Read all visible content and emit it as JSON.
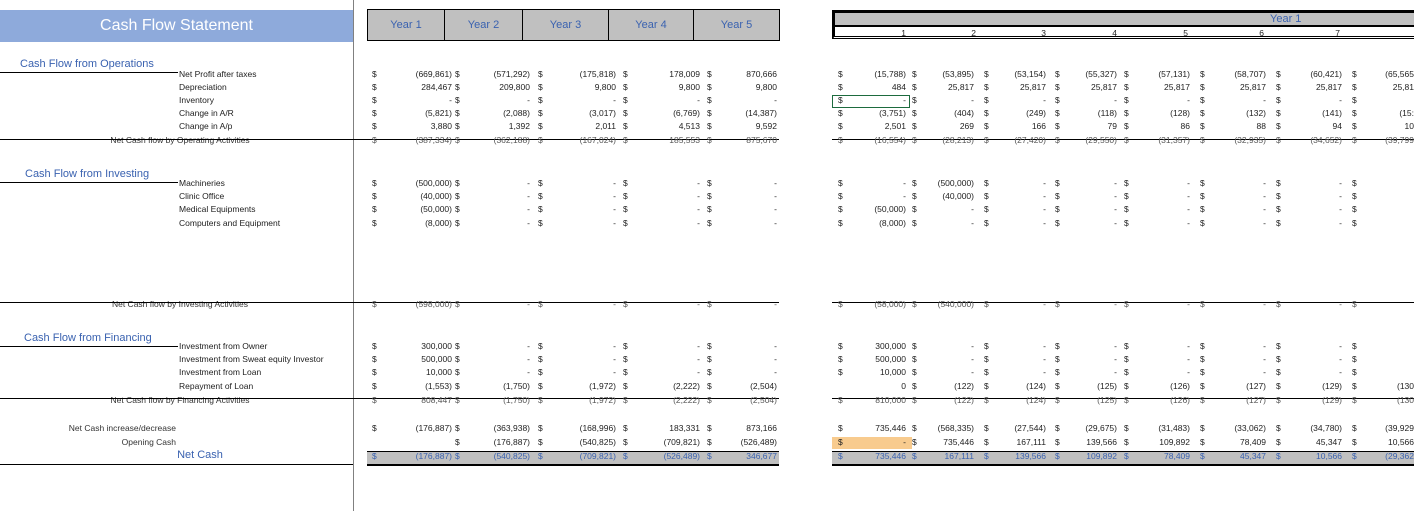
{
  "title": "Cash Flow Statement",
  "annual_headers": [
    "Year 1",
    "Year 2",
    "Year 3",
    "Year 4",
    "Year 5"
  ],
  "monthly_header": {
    "year_label": "Year 1",
    "months": [
      "1",
      "2",
      "3",
      "4",
      "5",
      "6",
      "7"
    ]
  },
  "currency_symbol": "$",
  "sections": {
    "operations": "Cash Flow from Operations",
    "investing": "Cash Flow from Investing",
    "financing": "Cash Flow from Financing"
  },
  "rows": [
    {
      "key": "npat",
      "label": "Net Profit after taxes",
      "annual": [
        "(669,861)",
        "(571,292)",
        "(175,818)",
        "178,009",
        "870,666"
      ],
      "monthly": [
        "(15,788)",
        "(53,895)",
        "(53,154)",
        "(55,327)",
        "(57,131)",
        "(58,707)",
        "(60,421)",
        "(65,565"
      ]
    },
    {
      "key": "dep",
      "label": "Depreciation",
      "annual": [
        "284,467",
        "209,800",
        "9,800",
        "9,800",
        "9,800"
      ],
      "monthly": [
        "484",
        "25,817",
        "25,817",
        "25,817",
        "25,817",
        "25,817",
        "25,817",
        "25,81"
      ]
    },
    {
      "key": "inv",
      "label": "Inventory",
      "annual": [
        "-",
        "-",
        "-",
        "-",
        "-"
      ],
      "monthly": [
        "-",
        "-",
        "-",
        "-",
        "-",
        "-",
        "-",
        ""
      ]
    },
    {
      "key": "ar",
      "label": "Change in A/R",
      "annual": [
        "(5,821)",
        "(2,088)",
        "(3,017)",
        "(6,769)",
        "(14,387)"
      ],
      "monthly": [
        "(3,751)",
        "(404)",
        "(249)",
        "(118)",
        "(128)",
        "(132)",
        "(141)",
        "(15:"
      ]
    },
    {
      "key": "ap",
      "label": "Change in A/p",
      "annual": [
        "3,880",
        "1,392",
        "2,011",
        "4,513",
        "9,592"
      ],
      "monthly": [
        "2,501",
        "269",
        "166",
        "79",
        "86",
        "88",
        "94",
        "10"
      ]
    },
    {
      "key": "net_op",
      "label": "Net Cash flow by Operating Activities",
      "annual": [
        "(387,334)",
        "(362,188)",
        "(167,024)",
        "185,553",
        "875,670"
      ],
      "monthly": [
        "(16,554)",
        "(28,213)",
        "(27,420)",
        "(29,550)",
        "(31,357)",
        "(32,935)",
        "(34,652)",
        "(39,799"
      ]
    },
    {
      "key": "mach",
      "label": "Machineries",
      "annual": [
        "(500,000)",
        "-",
        "-",
        "-",
        "-"
      ],
      "monthly": [
        "-",
        "(500,000)",
        "-",
        "-",
        "-",
        "-",
        "-",
        ""
      ]
    },
    {
      "key": "clinic",
      "label": "Clinic Office",
      "annual": [
        "(40,000)",
        "-",
        "-",
        "-",
        "-"
      ],
      "monthly": [
        "-",
        "(40,000)",
        "-",
        "-",
        "-",
        "-",
        "-",
        ""
      ]
    },
    {
      "key": "med",
      "label": "Medical Equipments",
      "annual": [
        "(50,000)",
        "-",
        "-",
        "-",
        "-"
      ],
      "monthly": [
        "(50,000)",
        "-",
        "-",
        "-",
        "-",
        "-",
        "-",
        ""
      ]
    },
    {
      "key": "comp",
      "label": "Computers and Equipment",
      "annual": [
        "(8,000)",
        "-",
        "-",
        "-",
        "-"
      ],
      "monthly": [
        "(8,000)",
        "-",
        "-",
        "-",
        "-",
        "-",
        "-",
        ""
      ]
    },
    {
      "key": "net_inv",
      "label": "Net Cash flow by Investing Activities",
      "annual": [
        "(598,000)",
        "-",
        "-",
        "-",
        "-"
      ],
      "monthly": [
        "(58,000)",
        "(540,000)",
        "-",
        "-",
        "-",
        "-",
        "-",
        ""
      ]
    },
    {
      "key": "owner",
      "label": "Investment from Owner",
      "annual": [
        "300,000",
        "-",
        "-",
        "-",
        "-"
      ],
      "monthly": [
        "300,000",
        "-",
        "-",
        "-",
        "-",
        "-",
        "-",
        ""
      ]
    },
    {
      "key": "sweat",
      "label": "Investment from Sweat equity Investor",
      "annual": [
        "500,000",
        "-",
        "-",
        "-",
        "-"
      ],
      "monthly": [
        "500,000",
        "-",
        "-",
        "-",
        "-",
        "-",
        "-",
        ""
      ]
    },
    {
      "key": "loan",
      "label": "Investment from Loan",
      "annual": [
        "10,000",
        "-",
        "-",
        "-",
        "-"
      ],
      "monthly": [
        "10,000",
        "-",
        "-",
        "-",
        "-",
        "-",
        "-",
        ""
      ]
    },
    {
      "key": "repay",
      "label": "Repayment of Loan",
      "annual": [
        "(1,553)",
        "(1,750)",
        "(1,972)",
        "(2,222)",
        "(2,504)"
      ],
      "monthly": [
        "0",
        "(122)",
        "(124)",
        "(125)",
        "(126)",
        "(127)",
        "(129)",
        "(130"
      ]
    },
    {
      "key": "net_fin",
      "label": "Net Cash flow by Financing Activities",
      "annual": [
        "808,447",
        "(1,750)",
        "(1,972)",
        "(2,222)",
        "(2,504)"
      ],
      "monthly": [
        "810,000",
        "(122)",
        "(124)",
        "(125)",
        "(126)",
        "(127)",
        "(129)",
        "(130"
      ]
    },
    {
      "key": "incdec",
      "label": "Net Cash increase/decrease",
      "annual": [
        "(176,887)",
        "(363,938)",
        "(168,996)",
        "183,331",
        "873,166"
      ],
      "monthly": [
        "735,446",
        "(568,335)",
        "(27,544)",
        "(29,675)",
        "(31,483)",
        "(33,062)",
        "(34,780)",
        "(39,929"
      ]
    },
    {
      "key": "opening",
      "label": "Opening Cash",
      "annual": [
        "",
        "(176,887)",
        "(540,825)",
        "(709,821)",
        "(526,489)"
      ],
      "monthly": [
        "-",
        "735,446",
        "167,111",
        "139,566",
        "109,892",
        "78,409",
        "45,347",
        "10,566"
      ]
    },
    {
      "key": "netcash",
      "label": "Net Cash",
      "annual": [
        "(176,887)",
        "(540,825)",
        "(709,821)",
        "(526,489)",
        "346,677"
      ],
      "monthly": [
        "735,446",
        "167,111",
        "139,566",
        "109,892",
        "78,409",
        "45,347",
        "10,566",
        "(29,362"
      ]
    }
  ]
}
